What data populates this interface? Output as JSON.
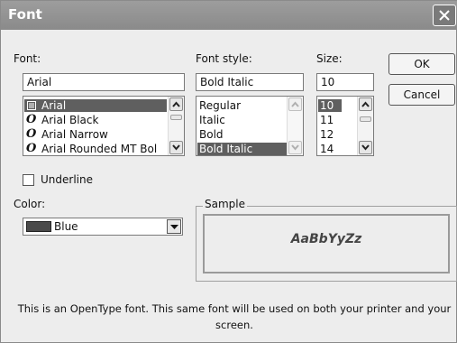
{
  "dialog": {
    "title": "Font",
    "close_icon": "close-icon"
  },
  "font": {
    "label": "Font:",
    "value": "Arial",
    "items": [
      {
        "label": "Arial",
        "icon": "printer-font-icon",
        "selected": true
      },
      {
        "label": "Arial Black",
        "icon": "opentype-icon",
        "selected": false
      },
      {
        "label": "Arial Narrow",
        "icon": "opentype-icon",
        "selected": false
      },
      {
        "label": "Arial Rounded MT Bol",
        "icon": "opentype-icon",
        "selected": false
      }
    ]
  },
  "style": {
    "label": "Font style:",
    "value": "Bold Italic",
    "items": [
      {
        "label": "Regular",
        "selected": false
      },
      {
        "label": "Italic",
        "selected": false
      },
      {
        "label": "Bold",
        "selected": false
      },
      {
        "label": "Bold Italic",
        "selected": true
      }
    ]
  },
  "size": {
    "label": "Size:",
    "value": "10",
    "items": [
      {
        "label": "10",
        "selected": true
      },
      {
        "label": "11",
        "selected": false
      },
      {
        "label": "12",
        "selected": false
      },
      {
        "label": "14",
        "selected": false
      }
    ]
  },
  "buttons": {
    "ok": "OK",
    "cancel": "Cancel"
  },
  "underline": {
    "label": "Underline",
    "checked": false
  },
  "color": {
    "label": "Color:",
    "value": "Blue",
    "swatch": "#4a4a4a"
  },
  "sample": {
    "label": "Sample",
    "text": "AaBbYyZz"
  },
  "description": "This is an OpenType font. This same font will be used on both your printer and your screen."
}
